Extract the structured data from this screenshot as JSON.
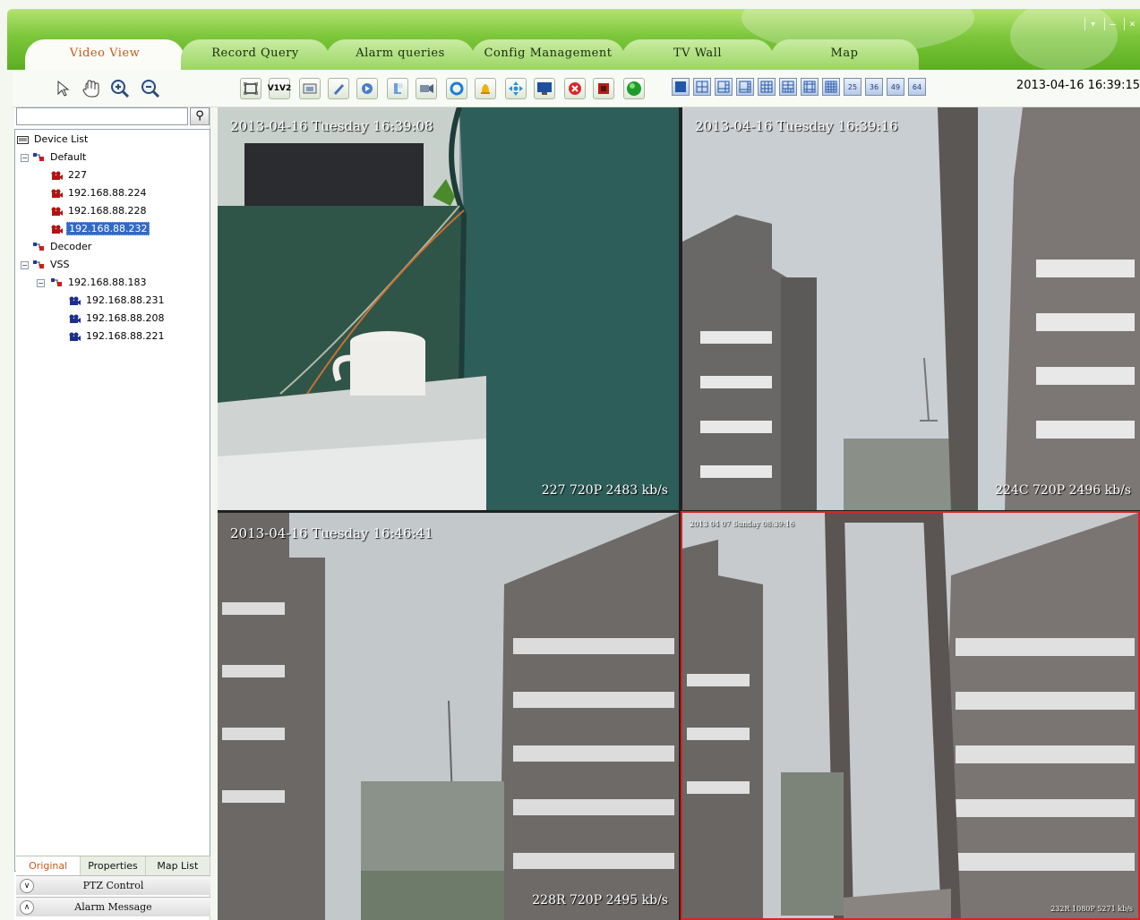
{
  "window": {
    "controls": [
      "▾",
      "–",
      "×"
    ]
  },
  "tabs": [
    "Video View",
    "Record Query",
    "Alarm queries",
    "Config Management",
    "TV Wall",
    "Map"
  ],
  "datetime": "2013-04-16 16:39:15",
  "toolbar": {
    "pointer_icons": [
      "pointer-icon",
      "hand-icon",
      "zoom-in-icon",
      "zoom-out-icon"
    ],
    "tools": [
      "fullscreen-icon",
      "v1v2-icon",
      "snapshot-icon",
      "pen-icon",
      "audio-icon",
      "talk-icon",
      "record-icon",
      "refresh-icon",
      "alarm-bell-icon",
      "ptz-icon",
      "monitor-icon",
      "close-stream-icon",
      "stop-icon",
      "status-icon"
    ],
    "v1v2_label": "V1V2",
    "layouts": [
      "1",
      "4",
      "6",
      "8",
      "9",
      "10",
      "13",
      "16",
      "25",
      "36",
      "49",
      "64"
    ]
  },
  "tree": {
    "root": "Device List",
    "groups": [
      {
        "label": "Default",
        "items": [
          "227",
          "192.168.88.224",
          "192.168.88.228",
          "192.168.88.232"
        ]
      },
      {
        "label": "Decoder",
        "items": []
      },
      {
        "label": "VSS",
        "sub": "192.168.88.183",
        "items": [
          "192.168.88.231",
          "192.168.88.208",
          "192.168.88.221"
        ]
      }
    ],
    "selected": "192.168.88.232"
  },
  "bottom_tabs": [
    "Original",
    "Properties",
    "Map List"
  ],
  "accordion": [
    "PTZ Control",
    "Alarm Message"
  ],
  "videos": [
    {
      "timestamp": "2013-04-16 Tuesday 16:39:08",
      "info": "227 720P 2483 kb/s"
    },
    {
      "timestamp": "2013-04-16 Tuesday 16:39:16",
      "info": "224C 720P 2496 kb/s"
    },
    {
      "timestamp": "2013-04-16 Tuesday 16:46:41",
      "info": "228R 720P 2495 kb/s"
    },
    {
      "timestamp": "2013 04 07 Sunday 08:39:16",
      "info": "232R 1080P 5271 kb/s"
    }
  ],
  "colors": {
    "accent_green": "#6cbc2c",
    "active_tab_text": "#c65c1c",
    "selection": "#3169c6",
    "active_pane_border": "#e02020"
  }
}
